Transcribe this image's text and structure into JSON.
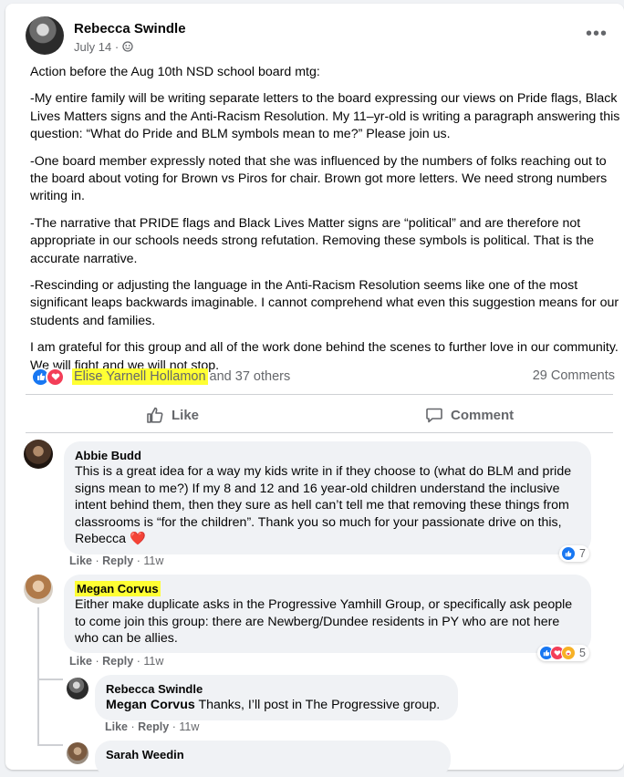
{
  "post": {
    "author": "Rebecca Swindle",
    "date": "July 14",
    "separator": "·",
    "more_label": "•••",
    "paragraphs": [
      "Action before the Aug 10th NSD school board mtg:",
      "-My entire family will be writing separate letters to the board expressing our views on Pride flags, Black Lives Matters signs and the Anti-Racism Resolution. My 11–yr-old is writing a paragraph answering this question: “What do Pride and BLM symbols mean to me?” Please join us.",
      "-One board member expressly noted that she was influenced by the numbers of folks reaching out to the board about voting for Brown vs Piros for chair. Brown got more letters. We need strong numbers writing in.",
      "-The narrative that PRIDE flags and Black Lives Matter signs are “political” and are therefore not appropriate in our schools needs  strong refutation. Removing these symbols is political. That is the accurate narrative.",
      "-Rescinding or adjusting the language in the Anti-Racism Resolution seems like one of the most significant leaps backwards imaginable. I cannot comprehend what even this suggestion means for our students and families.",
      "I am grateful for this group and all of the work done behind the scenes to further love in our community. We will fight and we will not stop."
    ],
    "reactions_name": "Elise Yarnell Hollamon",
    "reactions_rest": "and 37 others",
    "comments_count": "29 Comments",
    "like_label": "Like",
    "comment_label": "Comment"
  },
  "comments": [
    {
      "author": "Abbie Budd",
      "text": "This is a great idea for a way my kids write in if they choose to (what do BLM and pride signs mean to me?) If my 8 and 12 and 16 year-old children understand the inclusive intent behind them, then they sure as hell can’t tell me that removing these things from classrooms is “for the children”. Thank you so much for your passionate drive on this, Rebecca",
      "heart": "❤️",
      "like": "Like",
      "reply": "Reply",
      "time": "11w",
      "reaction_count": "7"
    },
    {
      "author": "Megan Corvus",
      "text": "Either make duplicate asks in the Progressive Yamhill Group, or specifically ask people to come join this group: there are Newberg/Dundee residents in PY who are not here who can be allies.",
      "like": "Like",
      "reply": "Reply",
      "time": "11w",
      "reaction_count": "5"
    },
    {
      "author": "Rebecca Swindle",
      "mention": "Megan Corvus",
      "text": " Thanks, I’ll post in The Progressive group.",
      "like": "Like",
      "reply": "Reply",
      "time": "11w"
    },
    {
      "author": "Sarah Weedin"
    }
  ],
  "ui": {
    "dot": "·",
    "accent": "#1877f2",
    "highlight": "#ffff33"
  }
}
